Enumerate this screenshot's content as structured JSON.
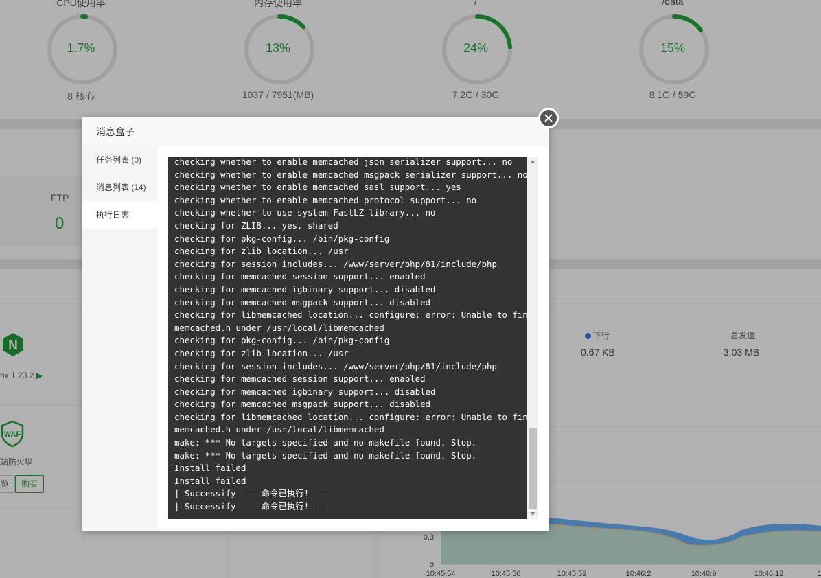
{
  "gauges": [
    {
      "title": "CPU使用率",
      "value": "1.7%",
      "sub": "8 核心",
      "percent": 1.7
    },
    {
      "title": "内存使用率",
      "value": "13%",
      "sub": "1037 / 7951(MB)",
      "percent": 13
    },
    {
      "title": "/",
      "value": "24%",
      "sub": "7.2G / 30G",
      "percent": 24
    },
    {
      "title": "/data",
      "value": "15%",
      "sub": "8.1G / 59G",
      "percent": 15
    }
  ],
  "ftp": {
    "label": "FTP",
    "value": "0"
  },
  "software": {
    "nginx_logo": "N",
    "nginx_version": "nx 1.23.2",
    "waf_logo": "WAF",
    "waf_name": "站防火墙",
    "view_button": "览",
    "buy_button": "购买"
  },
  "network": {
    "down_label": "下行",
    "down_value": "0.67 KB",
    "total_sent_label": "总发送",
    "total_sent_value": "3.03 MB"
  },
  "chart_data": {
    "type": "area",
    "x": [
      "10:45:54",
      "10:45:56",
      "10:45:59",
      "10:46:2",
      "10:46:9",
      "10:46:12",
      "1"
    ],
    "y_ticks": [
      "0",
      "0.3"
    ],
    "colors": {
      "up": "#f7b851",
      "down": "#52a9ff"
    }
  },
  "modal": {
    "title": "消息盒子",
    "tabs": [
      {
        "label": "任务列表 (0)"
      },
      {
        "label": "消息列表 (14)"
      },
      {
        "label": "执行日志"
      }
    ],
    "active_tab": 2,
    "log_lines": [
      "checking whether to enable memcached json serializer support... no",
      "checking whether to enable memcached msgpack serializer support... no",
      "checking whether to enable memcached sasl support... yes",
      "checking whether to enable memcached protocol support... no",
      "checking whether to use system FastLZ library... no",
      "checking for ZLIB... yes, shared",
      "checking for pkg-config... /bin/pkg-config",
      "checking for zlib location... /usr",
      "checking for session includes... /www/server/php/81/include/php",
      "checking for memcached session support... enabled",
      "checking for memcached igbinary support... disabled",
      "checking for memcached msgpack support... disabled",
      "checking for libmemcached location... configure: error: Unable to find",
      "memcached.h under /usr/local/libmemcached",
      "checking for pkg-config... /bin/pkg-config",
      "checking for zlib location... /usr",
      "checking for session includes... /www/server/php/81/include/php",
      "checking for memcached session support... enabled",
      "checking for memcached igbinary support... disabled",
      "checking for memcached msgpack support... disabled",
      "checking for libmemcached location... configure: error: Unable to find",
      "memcached.h under /usr/local/libmemcached",
      "make: *** No targets specified and no makefile found. Stop.",
      "make: *** No targets specified and no makefile found. Stop.",
      "Install failed",
      "Install failed",
      "|-Successify --- 命令已执行! ---",
      "|-Successify --- 命令已执行! ---"
    ]
  },
  "colors": {
    "accent": "#20a53a",
    "log_bg": "#333333"
  }
}
